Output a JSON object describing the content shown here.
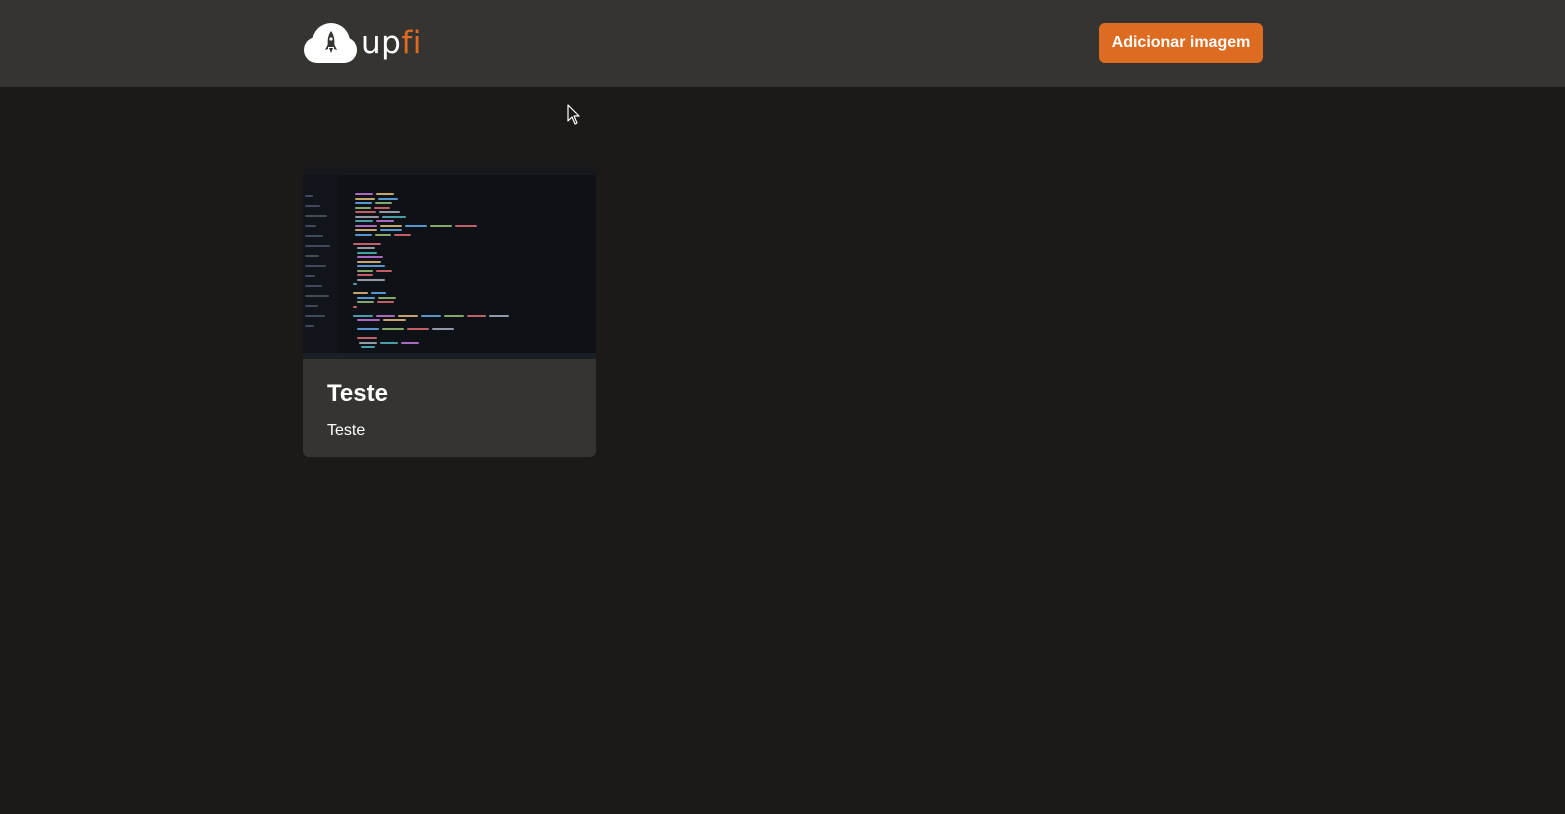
{
  "header": {
    "logo": {
      "text_primary": "up",
      "text_accent": "fi",
      "icon": "cloud-rocket-icon"
    },
    "add_button_label": "Adicionar imagem"
  },
  "colors": {
    "background": "#1b1a19",
    "header_background": "#353431",
    "accent": "#dd6b20",
    "card_background": "#353431",
    "text": "#ffffff"
  },
  "cards": [
    {
      "title": "Teste",
      "description": "Teste",
      "image": "code-editor-screenshot"
    }
  ]
}
